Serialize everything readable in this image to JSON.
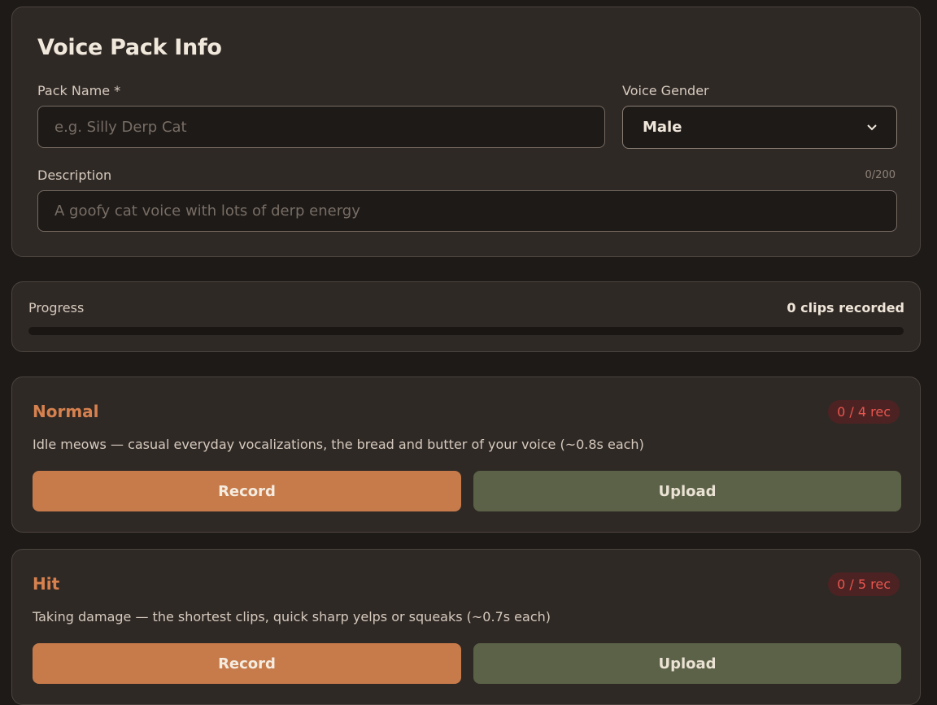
{
  "info": {
    "title": "Voice Pack Info",
    "pack_name_label": "Pack Name *",
    "pack_name_placeholder": "e.g. Silly Derp Cat",
    "pack_name_value": "",
    "gender_label": "Voice Gender",
    "gender_value": "Male",
    "description_label": "Description",
    "description_counter": "0/200",
    "description_placeholder": "A goofy cat voice with lots of derp energy",
    "description_value": ""
  },
  "progress": {
    "label": "Progress",
    "count_text": "0 clips recorded",
    "fraction": 0
  },
  "categories": [
    {
      "title": "Normal",
      "badge": "0 / 4 rec",
      "description": "Idle meows — casual everyday vocalizations, the bread and butter of your voice (~0.8s each)",
      "record_label": "Record",
      "upload_label": "Upload"
    },
    {
      "title": "Hit",
      "badge": "0 / 5 rec",
      "description": "Taking damage — the shortest clips, quick sharp yelps or squeaks (~0.7s each)",
      "record_label": "Record",
      "upload_label": "Upload"
    }
  ],
  "colors": {
    "accent": "#c77b4b",
    "upload": "#5b6247",
    "badge_text": "#e9554f",
    "badge_bg": "#4c2322"
  },
  "icons": {
    "gender_select": "chevron-down-icon"
  }
}
